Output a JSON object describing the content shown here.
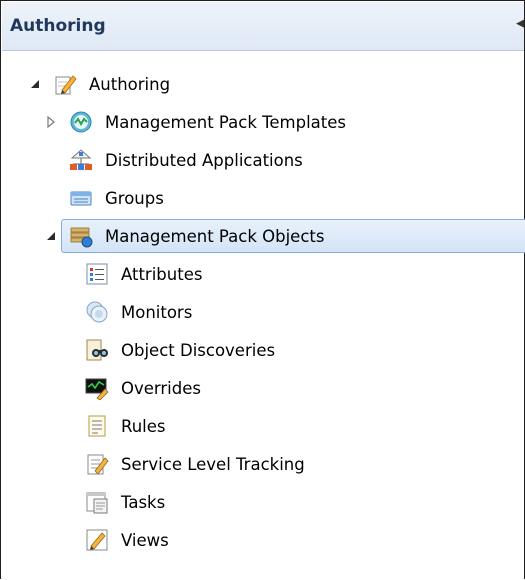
{
  "header": {
    "title": "Authoring"
  },
  "tree": {
    "root": {
      "label": "Authoring"
    },
    "items": [
      {
        "label": "Management Pack Templates"
      },
      {
        "label": "Distributed Applications"
      },
      {
        "label": "Groups"
      },
      {
        "label": "Management Pack Objects"
      }
    ],
    "children": [
      {
        "label": "Attributes"
      },
      {
        "label": "Monitors"
      },
      {
        "label": "Object Discoveries"
      },
      {
        "label": "Overrides"
      },
      {
        "label": "Rules"
      },
      {
        "label": "Service Level Tracking"
      },
      {
        "label": "Tasks"
      },
      {
        "label": "Views"
      }
    ]
  }
}
